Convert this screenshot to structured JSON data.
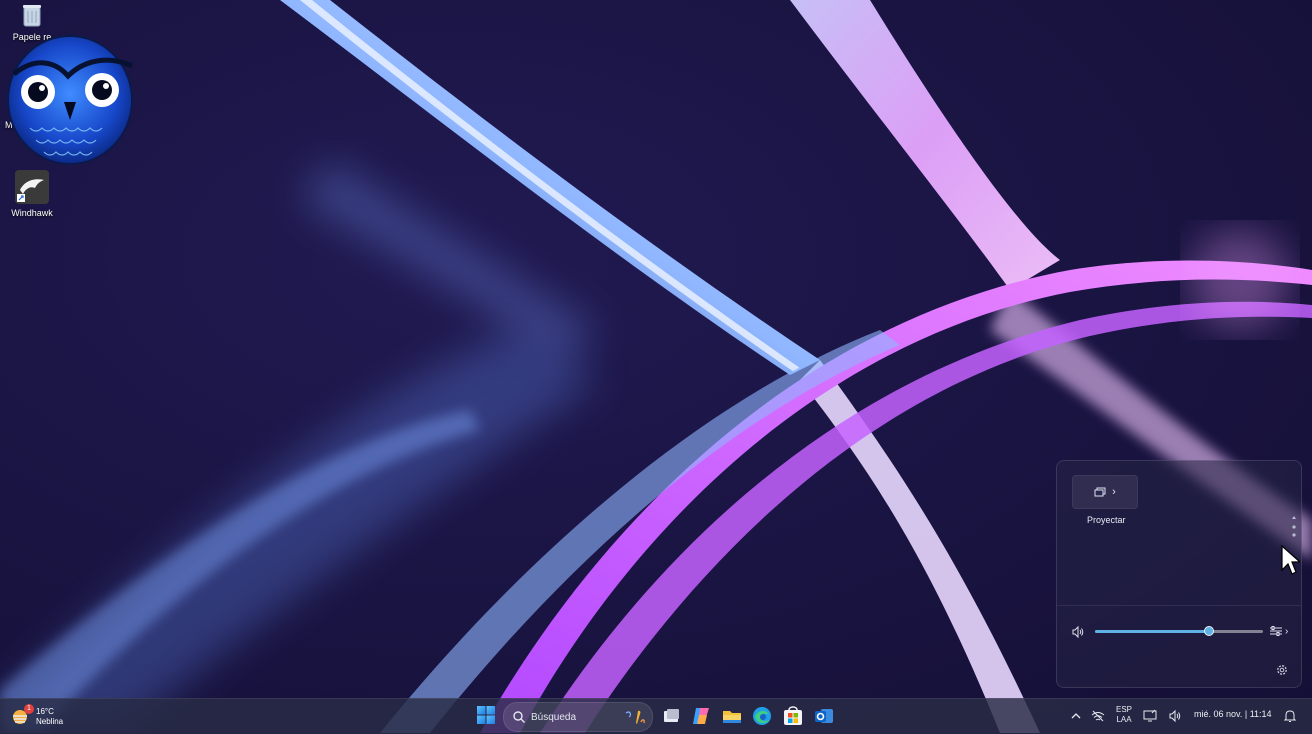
{
  "desktop": {
    "icons": [
      {
        "label": "Papele re",
        "icon": "recycle-bin-icon"
      },
      {
        "label": "Windhawk",
        "icon": "windhawk-icon"
      }
    ],
    "partial_label": "M",
    "overlay": "owl-logo"
  },
  "quick_settings": {
    "cast_tile_label": "Proyectar",
    "cast_icon": "cast-icon",
    "volume_level": 0.68,
    "accent": "#5fb2e6"
  },
  "taskbar": {
    "weather": {
      "temperature": "16°C",
      "condition": "Neblina",
      "badge": "1"
    },
    "search_placeholder": "Búsqueda",
    "apps": [
      "task-view-icon",
      "copilot-icon",
      "file-explorer-icon",
      "edge-icon",
      "microsoft-store-icon",
      "outlook-icon"
    ],
    "tray": {
      "language_top": "ESP",
      "language_bottom": "LAA",
      "clock": "mié. 06 nov. | 11:14"
    }
  }
}
